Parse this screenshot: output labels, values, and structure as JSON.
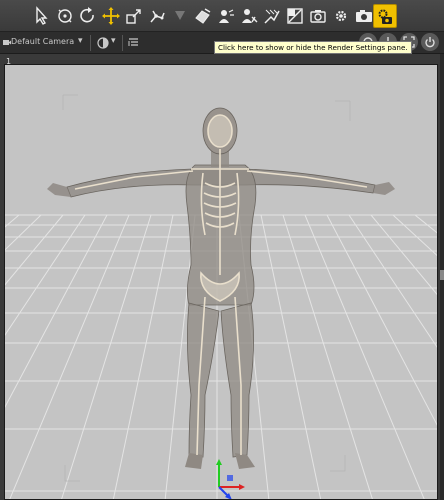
{
  "toolbar": {
    "tools": [
      {
        "name": "selection-tool-icon"
      },
      {
        "name": "universal-tool-icon"
      },
      {
        "name": "rotate-tool-icon"
      },
      {
        "name": "translate-tool-icon"
      },
      {
        "name": "scale-tool-icon"
      },
      {
        "name": "joint-editor-icon"
      },
      {
        "name": "geometry-tool-icon"
      },
      {
        "name": "surface-selection-icon"
      },
      {
        "name": "spot-render-icon"
      },
      {
        "name": "node-weight-map-icon"
      },
      {
        "name": "region-navigator-icon"
      },
      {
        "name": "render-icon"
      },
      {
        "name": "render-settings-icon"
      }
    ],
    "active_color": "#f0c000"
  },
  "viewport_bar": {
    "camera_label": "Default Camera",
    "camera_dropdown": "▾",
    "shading_dropdown": "▾"
  },
  "tooltip": {
    "text": "Click here to show or hide the Render Settings pane."
  },
  "viewport": {
    "number": "1",
    "background": "#c4c4c4",
    "grid_color": "#e6e6e6"
  }
}
